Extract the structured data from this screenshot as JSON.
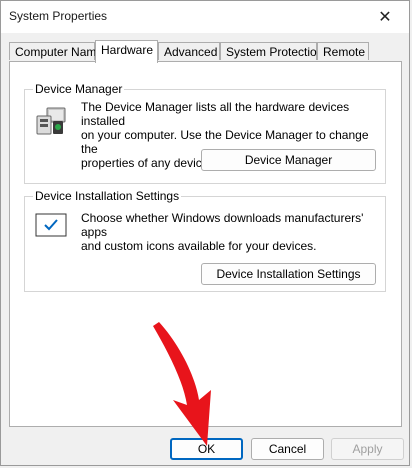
{
  "window": {
    "title": "System Properties",
    "close_glyph": "✕"
  },
  "tabs": [
    {
      "label": "Computer Name"
    },
    {
      "label": "Hardware"
    },
    {
      "label": "Advanced"
    },
    {
      "label": "System Protection"
    },
    {
      "label": "Remote"
    }
  ],
  "active_tab": "Hardware",
  "device_manager": {
    "group_label": "Device Manager",
    "description_lines": [
      "The Device Manager lists all the hardware devices installed",
      "on your computer. Use the Device Manager to change the",
      "properties of any device."
    ],
    "button_label": "Device Manager",
    "icon": "device-manager-icon"
  },
  "device_installation": {
    "group_label": "Device Installation Settings",
    "description_lines": [
      "Choose whether Windows downloads manufacturers' apps",
      "and custom icons available for your devices."
    ],
    "button_label": "Device Installation Settings",
    "icon": "checkbox-icon"
  },
  "footer": {
    "ok_label": "OK",
    "cancel_label": "Cancel",
    "apply_label": "Apply"
  },
  "colors": {
    "accent": "#0067c0",
    "arrow": "#e8141b",
    "check": "#0067c0"
  }
}
